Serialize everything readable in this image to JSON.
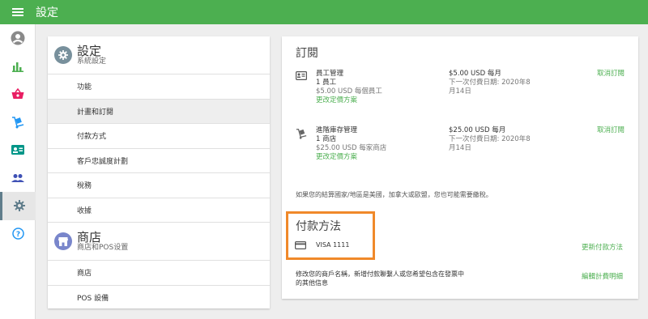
{
  "topbar": {
    "title": "設定",
    "menu_icon": "menu-icon"
  },
  "rail": {
    "items": [
      {
        "icon": "account-icon",
        "active": false
      },
      {
        "icon": "bar-chart-icon",
        "active": false
      },
      {
        "icon": "basket-icon",
        "active": false
      },
      {
        "icon": "dolly-icon",
        "active": false
      },
      {
        "icon": "badge-icon",
        "active": false
      },
      {
        "icon": "people-icon",
        "active": false
      },
      {
        "icon": "gear-icon",
        "active": true
      },
      {
        "icon": "help-icon",
        "active": false
      }
    ]
  },
  "left": {
    "settings": {
      "title": "設定",
      "subtitle": "系統設定",
      "items": [
        "功能",
        "計畫和訂閱",
        "付款方式",
        "客戶忠誠度計劃",
        "稅務",
        "收據"
      ]
    },
    "store": {
      "title": "商店",
      "subtitle": "商店和POS设置",
      "items": [
        "商店",
        "POS 設備"
      ]
    }
  },
  "subscriptions": {
    "title": "訂閱",
    "rows": [
      {
        "name": "員工管理",
        "qty": "1 員工",
        "rate": "$5.00 USD 每個員工",
        "change": "更改定價方案",
        "price": "$5.00 USD 每月",
        "next1": "下一次付費日期: 2020年8",
        "next2": "月14日",
        "cancel": "取消訂閱"
      },
      {
        "name": "進階庫存管理",
        "qty": "1 商店",
        "rate": "$25.00 USD 每家商店",
        "change": "更改定價方案",
        "price": "$25.00 USD 每月",
        "next1": "下一次付費日期: 2020年8",
        "next2": "月14日",
        "cancel": "取消訂閱"
      }
    ],
    "tax_note": "如果您的結算國家/地區是美國，加拿大或歐盟，您也可能需要繳稅。"
  },
  "payment": {
    "title": "付款方法",
    "card": "VISA 1111",
    "update": "更新付款方法",
    "bill_text": "修改您的商戶名稱，新增付款聯繫人或您希望包含在發票中的其他信息",
    "edit": "編輯計費明細"
  },
  "colors": {
    "brand_green": "#4caf50",
    "highlight_orange": "#f0892a",
    "settings_icon_bg": "#78909c",
    "store_icon_bg": "#7986cb"
  }
}
